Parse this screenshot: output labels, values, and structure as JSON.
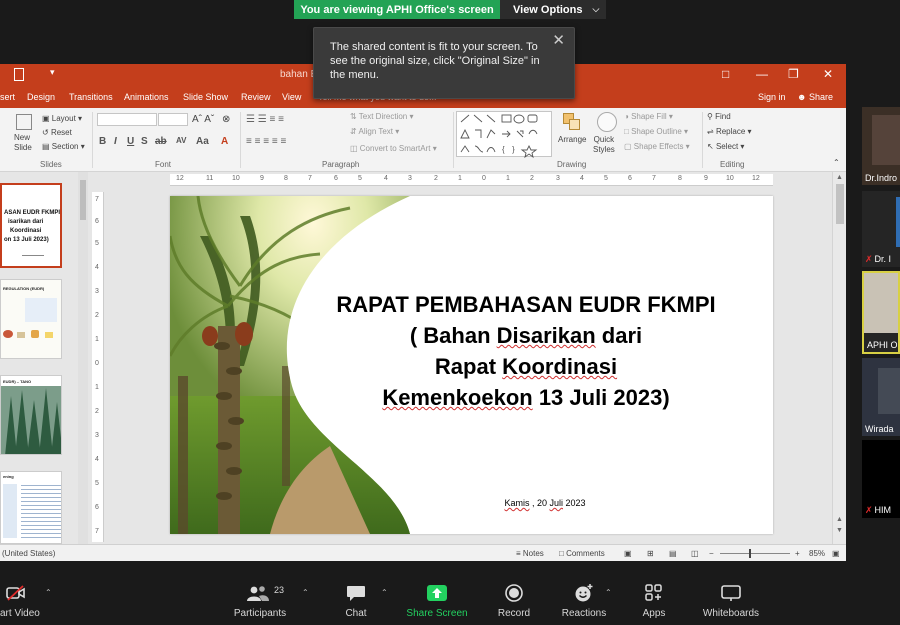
{
  "share_banner": {
    "text": "You are viewing APHI Office's screen",
    "view_options": "View Options"
  },
  "tooltip": {
    "text": "The shared content is fit to your screen. To see the original size, click \"Original Size\" in the menu."
  },
  "ppt": {
    "title_partial": "bahan E...2023 - PowerPoint",
    "tabs": [
      "sert",
      "Design",
      "Transitions",
      "Animations",
      "Slide Show",
      "Review",
      "View"
    ],
    "tell_me": "Tell me what you want to do...",
    "sign_in": "Sign in",
    "share": "Share",
    "ribbon": {
      "new_slide": "New\nSlide",
      "layout": "Layout",
      "reset": "Reset",
      "section": "Section",
      "text_direction": "Text Direction",
      "align_text": "Align Text",
      "convert_smartart": "Convert to SmartArt",
      "arrange": "Arrange",
      "quick_styles": "Quick\nStyles",
      "shape_fill": "Shape Fill",
      "shape_outline": "Shape Outline",
      "shape_effects": "Shape Effects",
      "find": "Find",
      "replace": "Replace",
      "select": "Select",
      "groups": [
        "Slides",
        "Font",
        "Paragraph",
        "Drawing",
        "Editing"
      ]
    },
    "thumbnails": [
      {
        "lines": [
          "ASAN EUDR FKMPI",
          "isarikan dari",
          "Koordinasi",
          "on 13 Juli 2023)"
        ]
      },
      {
        "lines": [
          "REGULATION (EUDR)"
        ]
      },
      {
        "lines": [
          "EUDR) – TANO"
        ]
      },
      {
        "lines": [
          "ening"
        ]
      }
    ],
    "slide": {
      "title_lines": [
        "RAPAT PEMBAHASAN EUDR FKMPI",
        "( Bahan Disarikan dari",
        "Rapat Koordinasi",
        "Kemenkoekon 13 Juli 2023)"
      ],
      "date": "Kamis , 20 Juli 2023"
    },
    "status": {
      "language": "(United States)",
      "notes": "Notes",
      "comments": "Comments",
      "zoom": "85%"
    }
  },
  "participants": [
    {
      "name": "Dr.Indro"
    },
    {
      "name": "Dr. I"
    },
    {
      "name": "APHI O"
    },
    {
      "name": "Wirada"
    },
    {
      "name": "HIM"
    }
  ],
  "toolbar": {
    "start_video": "art Video",
    "participants": "Participants",
    "participants_count": "23",
    "chat": "Chat",
    "share_screen": "Share Screen",
    "record": "Record",
    "reactions": "Reactions",
    "apps": "Apps",
    "whiteboards": "Whiteboards"
  },
  "colors": {
    "ppt_accent": "#c43e1c",
    "zoom_green": "#23a355",
    "active_border": "#d8d044"
  }
}
